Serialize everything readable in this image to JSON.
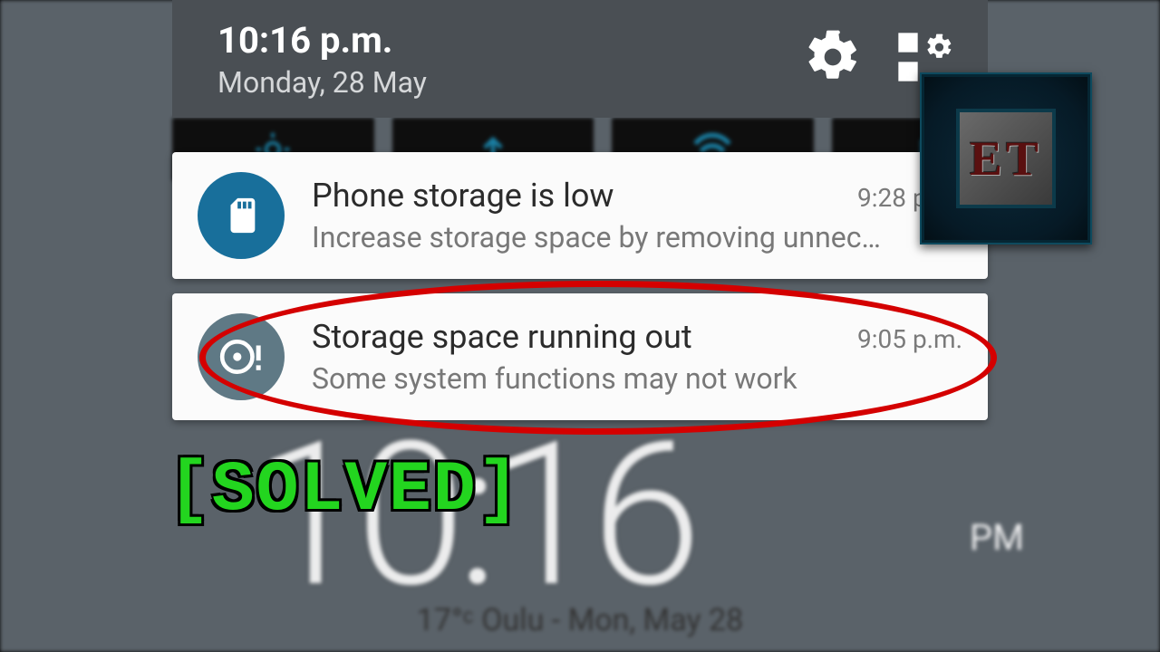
{
  "header": {
    "time": "10:16 p.m.",
    "date": "Monday, 28 May",
    "icons": [
      "gear-icon",
      "quicksettings-icon"
    ]
  },
  "notifications": [
    {
      "icon": "sdcard-icon",
      "icon_color": "#186f9b",
      "title": "Phone storage is low",
      "subtitle": "Increase storage space by removing unnec…",
      "timestamp": "9:28 p.m."
    },
    {
      "icon": "disc-alert-icon",
      "icon_color": "#5f7985",
      "title": "Storage space running out",
      "subtitle": "Some system functions may not work",
      "timestamp": "9:05 p.m."
    }
  ],
  "background": {
    "clock": "10:16",
    "ampm": "PM",
    "weather": "17°ᶜ Oulu - Mon, May 28"
  },
  "annotation": {
    "solved_label": "[SOLVED]",
    "watermark_text": "ET"
  }
}
